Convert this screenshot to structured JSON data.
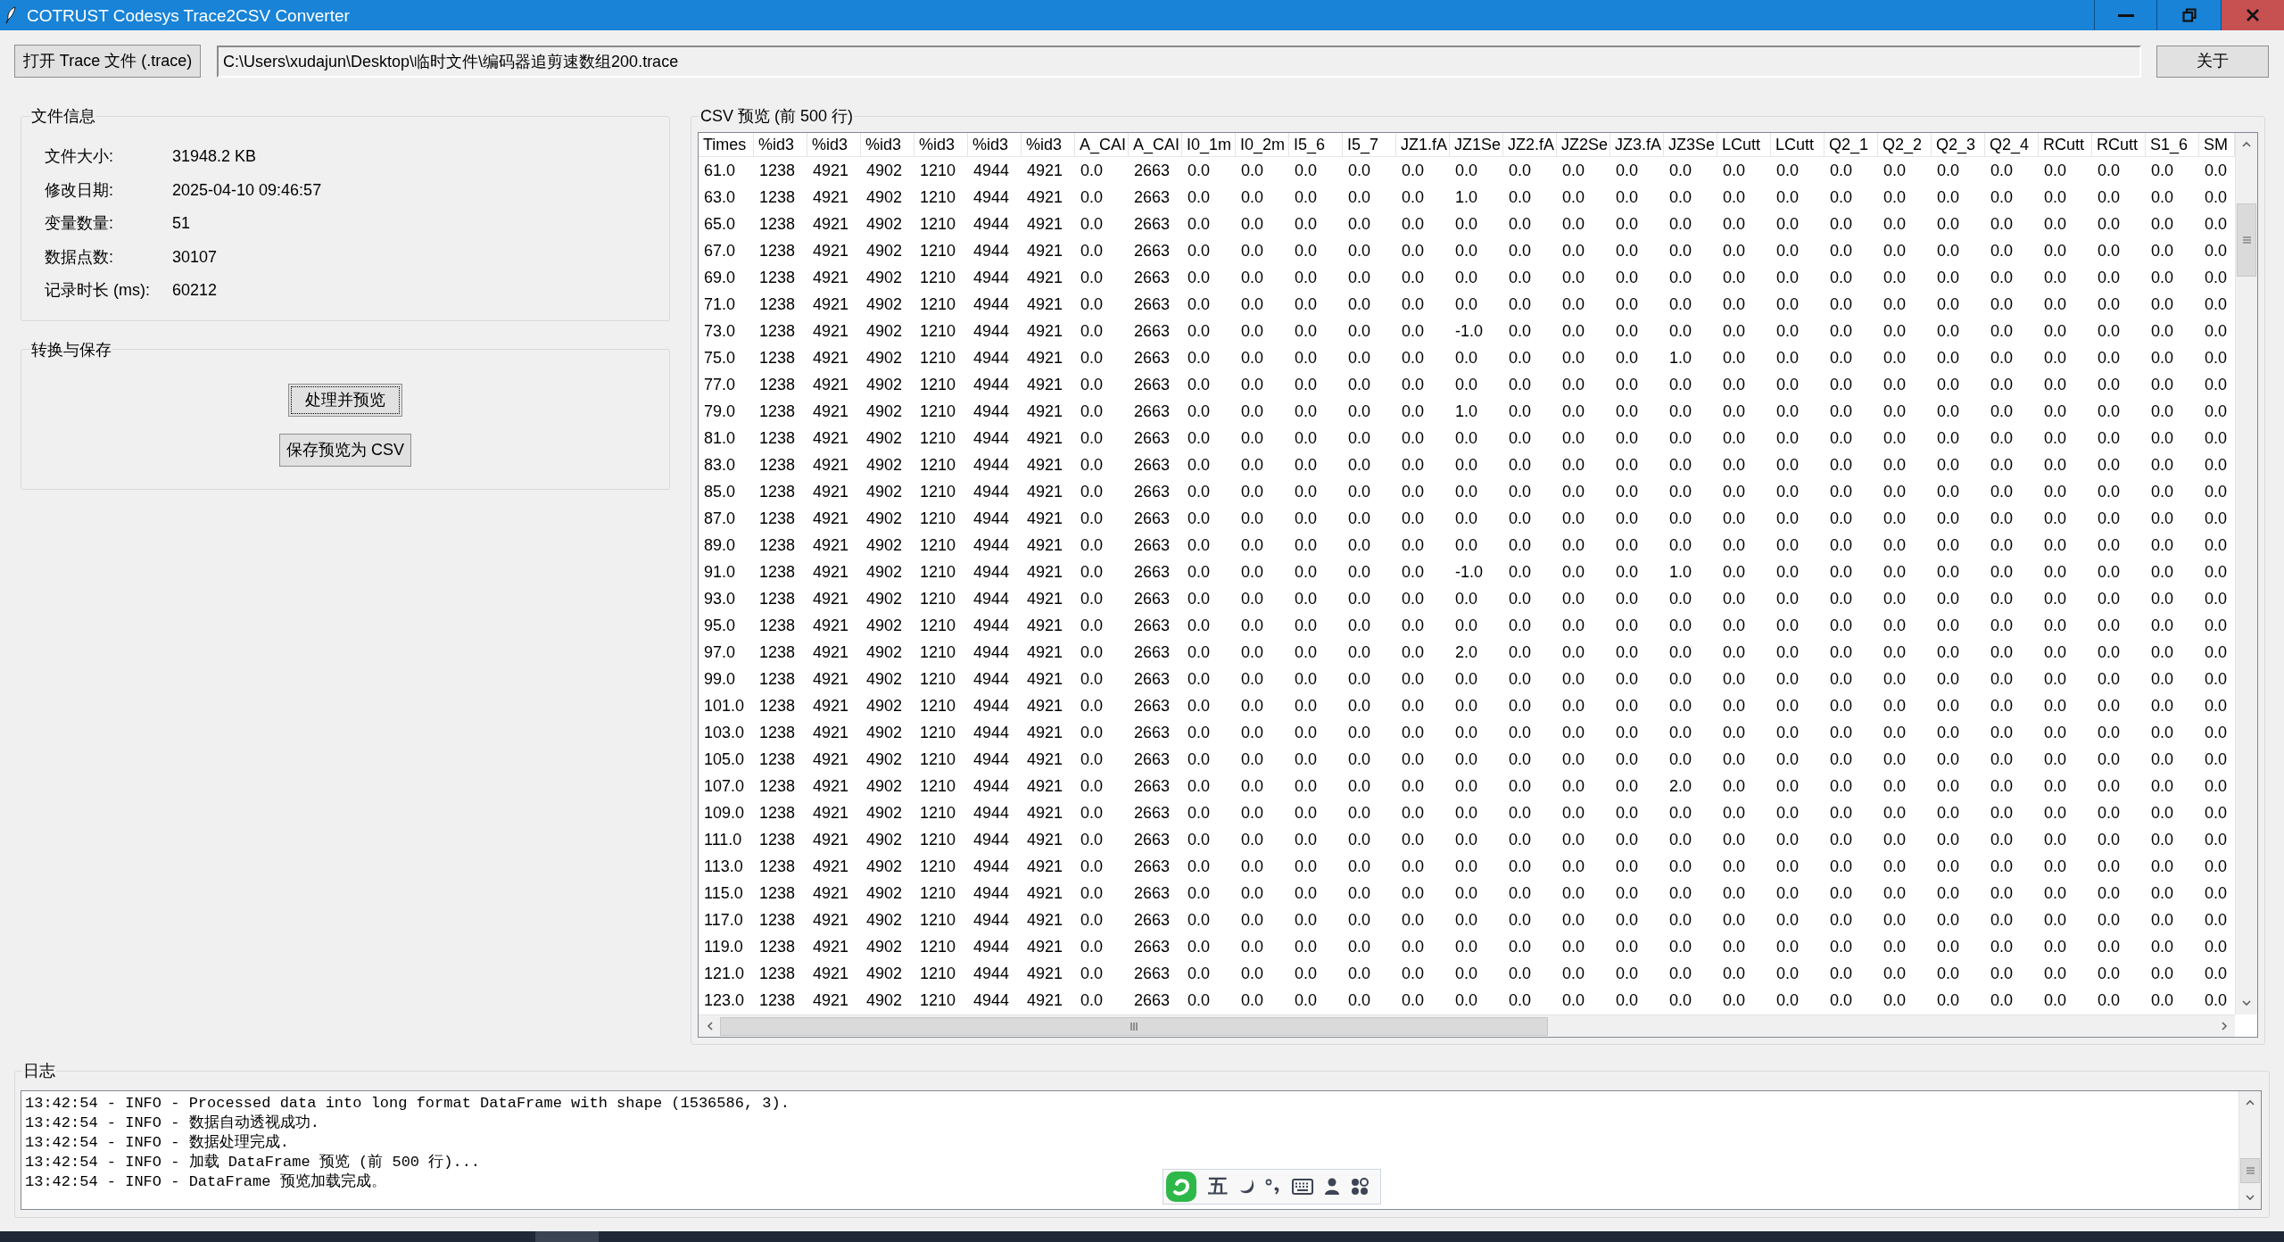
{
  "window": {
    "title": "COTRUST Codesys Trace2CSV Converter"
  },
  "toolbar": {
    "open_button": "打开 Trace 文件 (.trace)",
    "path_field": {
      "value": "C:\\Users\\xudajun\\Desktop\\临时文件\\编码器追剪速数组200.trace"
    },
    "about_button": "关于"
  },
  "file_info": {
    "title": "文件信息",
    "rows": [
      {
        "label": "文件大小:",
        "value": "31948.2 KB"
      },
      {
        "label": "修改日期:",
        "value": "2025-04-10 09:46:57"
      },
      {
        "label": "变量数量:",
        "value": "51"
      },
      {
        "label": "数据点数:",
        "value": "30107"
      },
      {
        "label": "记录时长 (ms):",
        "value": "60212"
      }
    ]
  },
  "convert_save": {
    "title": "转换与保存",
    "buttons": [
      {
        "label": "处理并预览",
        "focused": true
      },
      {
        "label": "保存预览为 CSV",
        "focused": false
      }
    ]
  },
  "csv_preview": {
    "title": "CSV 预览 (前 500 行)",
    "table": {
      "columns": [
        "Times",
        "%id3",
        "%id3",
        "%id3",
        "%id3",
        "%id3",
        "%id3",
        "A_CAI",
        "A_CAI",
        "I0_1m",
        "I0_2m",
        "I5_6",
        "I5_7",
        "JZ1.fA",
        "JZ1Se",
        "JZ2.fA",
        "JZ2Se",
        "JZ3.fA",
        "JZ3Se",
        "LCutt",
        "LCutt",
        "Q2_1",
        "Q2_2",
        "Q2_3",
        "Q2_4",
        "RCutt",
        "RCutt",
        "S1_6",
        "SM"
      ],
      "rows": [
        [
          "61.0",
          "1238",
          "4921",
          "4902",
          "1210",
          "4944",
          "4921",
          "0.0",
          "2663",
          "0.0",
          "0.0",
          "0.0",
          "0.0",
          "0.0",
          "0.0",
          "0.0",
          "0.0",
          "0.0",
          "0.0",
          "0.0",
          "0.0",
          "0.0",
          "0.0",
          "0.0",
          "0.0",
          "0.0",
          "0.0",
          "0.0",
          "0.0"
        ],
        [
          "63.0",
          "1238",
          "4921",
          "4902",
          "1210",
          "4944",
          "4921",
          "0.0",
          "2663",
          "0.0",
          "0.0",
          "0.0",
          "0.0",
          "0.0",
          "1.0",
          "0.0",
          "0.0",
          "0.0",
          "0.0",
          "0.0",
          "0.0",
          "0.0",
          "0.0",
          "0.0",
          "0.0",
          "0.0",
          "0.0",
          "0.0",
          "0.0"
        ],
        [
          "65.0",
          "1238",
          "4921",
          "4902",
          "1210",
          "4944",
          "4921",
          "0.0",
          "2663",
          "0.0",
          "0.0",
          "0.0",
          "0.0",
          "0.0",
          "0.0",
          "0.0",
          "0.0",
          "0.0",
          "0.0",
          "0.0",
          "0.0",
          "0.0",
          "0.0",
          "0.0",
          "0.0",
          "0.0",
          "0.0",
          "0.0",
          "0.0"
        ],
        [
          "67.0",
          "1238",
          "4921",
          "4902",
          "1210",
          "4944",
          "4921",
          "0.0",
          "2663",
          "0.0",
          "0.0",
          "0.0",
          "0.0",
          "0.0",
          "0.0",
          "0.0",
          "0.0",
          "0.0",
          "0.0",
          "0.0",
          "0.0",
          "0.0",
          "0.0",
          "0.0",
          "0.0",
          "0.0",
          "0.0",
          "0.0",
          "0.0"
        ],
        [
          "69.0",
          "1238",
          "4921",
          "4902",
          "1210",
          "4944",
          "4921",
          "0.0",
          "2663",
          "0.0",
          "0.0",
          "0.0",
          "0.0",
          "0.0",
          "0.0",
          "0.0",
          "0.0",
          "0.0",
          "0.0",
          "0.0",
          "0.0",
          "0.0",
          "0.0",
          "0.0",
          "0.0",
          "0.0",
          "0.0",
          "0.0",
          "0.0"
        ],
        [
          "71.0",
          "1238",
          "4921",
          "4902",
          "1210",
          "4944",
          "4921",
          "0.0",
          "2663",
          "0.0",
          "0.0",
          "0.0",
          "0.0",
          "0.0",
          "0.0",
          "0.0",
          "0.0",
          "0.0",
          "0.0",
          "0.0",
          "0.0",
          "0.0",
          "0.0",
          "0.0",
          "0.0",
          "0.0",
          "0.0",
          "0.0",
          "0.0"
        ],
        [
          "73.0",
          "1238",
          "4921",
          "4902",
          "1210",
          "4944",
          "4921",
          "0.0",
          "2663",
          "0.0",
          "0.0",
          "0.0",
          "0.0",
          "0.0",
          "-1.0",
          "0.0",
          "0.0",
          "0.0",
          "0.0",
          "0.0",
          "0.0",
          "0.0",
          "0.0",
          "0.0",
          "0.0",
          "0.0",
          "0.0",
          "0.0",
          "0.0"
        ],
        [
          "75.0",
          "1238",
          "4921",
          "4902",
          "1210",
          "4944",
          "4921",
          "0.0",
          "2663",
          "0.0",
          "0.0",
          "0.0",
          "0.0",
          "0.0",
          "0.0",
          "0.0",
          "0.0",
          "0.0",
          "1.0",
          "0.0",
          "0.0",
          "0.0",
          "0.0",
          "0.0",
          "0.0",
          "0.0",
          "0.0",
          "0.0",
          "0.0"
        ],
        [
          "77.0",
          "1238",
          "4921",
          "4902",
          "1210",
          "4944",
          "4921",
          "0.0",
          "2663",
          "0.0",
          "0.0",
          "0.0",
          "0.0",
          "0.0",
          "0.0",
          "0.0",
          "0.0",
          "0.0",
          "0.0",
          "0.0",
          "0.0",
          "0.0",
          "0.0",
          "0.0",
          "0.0",
          "0.0",
          "0.0",
          "0.0",
          "0.0"
        ],
        [
          "79.0",
          "1238",
          "4921",
          "4902",
          "1210",
          "4944",
          "4921",
          "0.0",
          "2663",
          "0.0",
          "0.0",
          "0.0",
          "0.0",
          "0.0",
          "1.0",
          "0.0",
          "0.0",
          "0.0",
          "0.0",
          "0.0",
          "0.0",
          "0.0",
          "0.0",
          "0.0",
          "0.0",
          "0.0",
          "0.0",
          "0.0",
          "0.0"
        ],
        [
          "81.0",
          "1238",
          "4921",
          "4902",
          "1210",
          "4944",
          "4921",
          "0.0",
          "2663",
          "0.0",
          "0.0",
          "0.0",
          "0.0",
          "0.0",
          "0.0",
          "0.0",
          "0.0",
          "0.0",
          "0.0",
          "0.0",
          "0.0",
          "0.0",
          "0.0",
          "0.0",
          "0.0",
          "0.0",
          "0.0",
          "0.0",
          "0.0"
        ],
        [
          "83.0",
          "1238",
          "4921",
          "4902",
          "1210",
          "4944",
          "4921",
          "0.0",
          "2663",
          "0.0",
          "0.0",
          "0.0",
          "0.0",
          "0.0",
          "0.0",
          "0.0",
          "0.0",
          "0.0",
          "0.0",
          "0.0",
          "0.0",
          "0.0",
          "0.0",
          "0.0",
          "0.0",
          "0.0",
          "0.0",
          "0.0",
          "0.0"
        ],
        [
          "85.0",
          "1238",
          "4921",
          "4902",
          "1210",
          "4944",
          "4921",
          "0.0",
          "2663",
          "0.0",
          "0.0",
          "0.0",
          "0.0",
          "0.0",
          "0.0",
          "0.0",
          "0.0",
          "0.0",
          "0.0",
          "0.0",
          "0.0",
          "0.0",
          "0.0",
          "0.0",
          "0.0",
          "0.0",
          "0.0",
          "0.0",
          "0.0"
        ],
        [
          "87.0",
          "1238",
          "4921",
          "4902",
          "1210",
          "4944",
          "4921",
          "0.0",
          "2663",
          "0.0",
          "0.0",
          "0.0",
          "0.0",
          "0.0",
          "0.0",
          "0.0",
          "0.0",
          "0.0",
          "0.0",
          "0.0",
          "0.0",
          "0.0",
          "0.0",
          "0.0",
          "0.0",
          "0.0",
          "0.0",
          "0.0",
          "0.0"
        ],
        [
          "89.0",
          "1238",
          "4921",
          "4902",
          "1210",
          "4944",
          "4921",
          "0.0",
          "2663",
          "0.0",
          "0.0",
          "0.0",
          "0.0",
          "0.0",
          "0.0",
          "0.0",
          "0.0",
          "0.0",
          "0.0",
          "0.0",
          "0.0",
          "0.0",
          "0.0",
          "0.0",
          "0.0",
          "0.0",
          "0.0",
          "0.0",
          "0.0"
        ],
        [
          "91.0",
          "1238",
          "4921",
          "4902",
          "1210",
          "4944",
          "4921",
          "0.0",
          "2663",
          "0.0",
          "0.0",
          "0.0",
          "0.0",
          "0.0",
          "-1.0",
          "0.0",
          "0.0",
          "0.0",
          "1.0",
          "0.0",
          "0.0",
          "0.0",
          "0.0",
          "0.0",
          "0.0",
          "0.0",
          "0.0",
          "0.0",
          "0.0"
        ],
        [
          "93.0",
          "1238",
          "4921",
          "4902",
          "1210",
          "4944",
          "4921",
          "0.0",
          "2663",
          "0.0",
          "0.0",
          "0.0",
          "0.0",
          "0.0",
          "0.0",
          "0.0",
          "0.0",
          "0.0",
          "0.0",
          "0.0",
          "0.0",
          "0.0",
          "0.0",
          "0.0",
          "0.0",
          "0.0",
          "0.0",
          "0.0",
          "0.0"
        ],
        [
          "95.0",
          "1238",
          "4921",
          "4902",
          "1210",
          "4944",
          "4921",
          "0.0",
          "2663",
          "0.0",
          "0.0",
          "0.0",
          "0.0",
          "0.0",
          "0.0",
          "0.0",
          "0.0",
          "0.0",
          "0.0",
          "0.0",
          "0.0",
          "0.0",
          "0.0",
          "0.0",
          "0.0",
          "0.0",
          "0.0",
          "0.0",
          "0.0"
        ],
        [
          "97.0",
          "1238",
          "4921",
          "4902",
          "1210",
          "4944",
          "4921",
          "0.0",
          "2663",
          "0.0",
          "0.0",
          "0.0",
          "0.0",
          "0.0",
          "2.0",
          "0.0",
          "0.0",
          "0.0",
          "0.0",
          "0.0",
          "0.0",
          "0.0",
          "0.0",
          "0.0",
          "0.0",
          "0.0",
          "0.0",
          "0.0",
          "0.0"
        ],
        [
          "99.0",
          "1238",
          "4921",
          "4902",
          "1210",
          "4944",
          "4921",
          "0.0",
          "2663",
          "0.0",
          "0.0",
          "0.0",
          "0.0",
          "0.0",
          "0.0",
          "0.0",
          "0.0",
          "0.0",
          "0.0",
          "0.0",
          "0.0",
          "0.0",
          "0.0",
          "0.0",
          "0.0",
          "0.0",
          "0.0",
          "0.0",
          "0.0"
        ],
        [
          "101.0",
          "1238",
          "4921",
          "4902",
          "1210",
          "4944",
          "4921",
          "0.0",
          "2663",
          "0.0",
          "0.0",
          "0.0",
          "0.0",
          "0.0",
          "0.0",
          "0.0",
          "0.0",
          "0.0",
          "0.0",
          "0.0",
          "0.0",
          "0.0",
          "0.0",
          "0.0",
          "0.0",
          "0.0",
          "0.0",
          "0.0",
          "0.0"
        ],
        [
          "103.0",
          "1238",
          "4921",
          "4902",
          "1210",
          "4944",
          "4921",
          "0.0",
          "2663",
          "0.0",
          "0.0",
          "0.0",
          "0.0",
          "0.0",
          "0.0",
          "0.0",
          "0.0",
          "0.0",
          "0.0",
          "0.0",
          "0.0",
          "0.0",
          "0.0",
          "0.0",
          "0.0",
          "0.0",
          "0.0",
          "0.0",
          "0.0"
        ],
        [
          "105.0",
          "1238",
          "4921",
          "4902",
          "1210",
          "4944",
          "4921",
          "0.0",
          "2663",
          "0.0",
          "0.0",
          "0.0",
          "0.0",
          "0.0",
          "0.0",
          "0.0",
          "0.0",
          "0.0",
          "0.0",
          "0.0",
          "0.0",
          "0.0",
          "0.0",
          "0.0",
          "0.0",
          "0.0",
          "0.0",
          "0.0",
          "0.0"
        ],
        [
          "107.0",
          "1238",
          "4921",
          "4902",
          "1210",
          "4944",
          "4921",
          "0.0",
          "2663",
          "0.0",
          "0.0",
          "0.0",
          "0.0",
          "0.0",
          "0.0",
          "0.0",
          "0.0",
          "0.0",
          "2.0",
          "0.0",
          "0.0",
          "0.0",
          "0.0",
          "0.0",
          "0.0",
          "0.0",
          "0.0",
          "0.0",
          "0.0"
        ],
        [
          "109.0",
          "1238",
          "4921",
          "4902",
          "1210",
          "4944",
          "4921",
          "0.0",
          "2663",
          "0.0",
          "0.0",
          "0.0",
          "0.0",
          "0.0",
          "0.0",
          "0.0",
          "0.0",
          "0.0",
          "0.0",
          "0.0",
          "0.0",
          "0.0",
          "0.0",
          "0.0",
          "0.0",
          "0.0",
          "0.0",
          "0.0",
          "0.0"
        ],
        [
          "111.0",
          "1238",
          "4921",
          "4902",
          "1210",
          "4944",
          "4921",
          "0.0",
          "2663",
          "0.0",
          "0.0",
          "0.0",
          "0.0",
          "0.0",
          "0.0",
          "0.0",
          "0.0",
          "0.0",
          "0.0",
          "0.0",
          "0.0",
          "0.0",
          "0.0",
          "0.0",
          "0.0",
          "0.0",
          "0.0",
          "0.0",
          "0.0"
        ],
        [
          "113.0",
          "1238",
          "4921",
          "4902",
          "1210",
          "4944",
          "4921",
          "0.0",
          "2663",
          "0.0",
          "0.0",
          "0.0",
          "0.0",
          "0.0",
          "0.0",
          "0.0",
          "0.0",
          "0.0",
          "0.0",
          "0.0",
          "0.0",
          "0.0",
          "0.0",
          "0.0",
          "0.0",
          "0.0",
          "0.0",
          "0.0",
          "0.0"
        ],
        [
          "115.0",
          "1238",
          "4921",
          "4902",
          "1210",
          "4944",
          "4921",
          "0.0",
          "2663",
          "0.0",
          "0.0",
          "0.0",
          "0.0",
          "0.0",
          "0.0",
          "0.0",
          "0.0",
          "0.0",
          "0.0",
          "0.0",
          "0.0",
          "0.0",
          "0.0",
          "0.0",
          "0.0",
          "0.0",
          "0.0",
          "0.0",
          "0.0"
        ],
        [
          "117.0",
          "1238",
          "4921",
          "4902",
          "1210",
          "4944",
          "4921",
          "0.0",
          "2663",
          "0.0",
          "0.0",
          "0.0",
          "0.0",
          "0.0",
          "0.0",
          "0.0",
          "0.0",
          "0.0",
          "0.0",
          "0.0",
          "0.0",
          "0.0",
          "0.0",
          "0.0",
          "0.0",
          "0.0",
          "0.0",
          "0.0",
          "0.0"
        ],
        [
          "119.0",
          "1238",
          "4921",
          "4902",
          "1210",
          "4944",
          "4921",
          "0.0",
          "2663",
          "0.0",
          "0.0",
          "0.0",
          "0.0",
          "0.0",
          "0.0",
          "0.0",
          "0.0",
          "0.0",
          "0.0",
          "0.0",
          "0.0",
          "0.0",
          "0.0",
          "0.0",
          "0.0",
          "0.0",
          "0.0",
          "0.0",
          "0.0"
        ],
        [
          "121.0",
          "1238",
          "4921",
          "4902",
          "1210",
          "4944",
          "4921",
          "0.0",
          "2663",
          "0.0",
          "0.0",
          "0.0",
          "0.0",
          "0.0",
          "0.0",
          "0.0",
          "0.0",
          "0.0",
          "0.0",
          "0.0",
          "0.0",
          "0.0",
          "0.0",
          "0.0",
          "0.0",
          "0.0",
          "0.0",
          "0.0",
          "0.0"
        ],
        [
          "123.0",
          "1238",
          "4921",
          "4902",
          "1210",
          "4944",
          "4921",
          "0.0",
          "2663",
          "0.0",
          "0.0",
          "0.0",
          "0.0",
          "0.0",
          "0.0",
          "0.0",
          "0.0",
          "0.0",
          "0.0",
          "0.0",
          "0.0",
          "0.0",
          "0.0",
          "0.0",
          "0.0",
          "0.0",
          "0.0",
          "0.0",
          "0.0"
        ]
      ]
    }
  },
  "log": {
    "title": "日志",
    "lines": [
      "13:42:54 - INFO - Processed data into long format DataFrame with shape (1536586, 3).",
      "13:42:54 - INFO - 数据自动透视成功.",
      "13:42:54 - INFO - 数据处理完成.",
      "13:42:54 - INFO - 加载 DataFrame 预览 (前 500 行)...",
      "13:42:54 - INFO - DataFrame 预览加载完成。"
    ]
  },
  "ime_toolbar": {
    "mode": "五"
  }
}
